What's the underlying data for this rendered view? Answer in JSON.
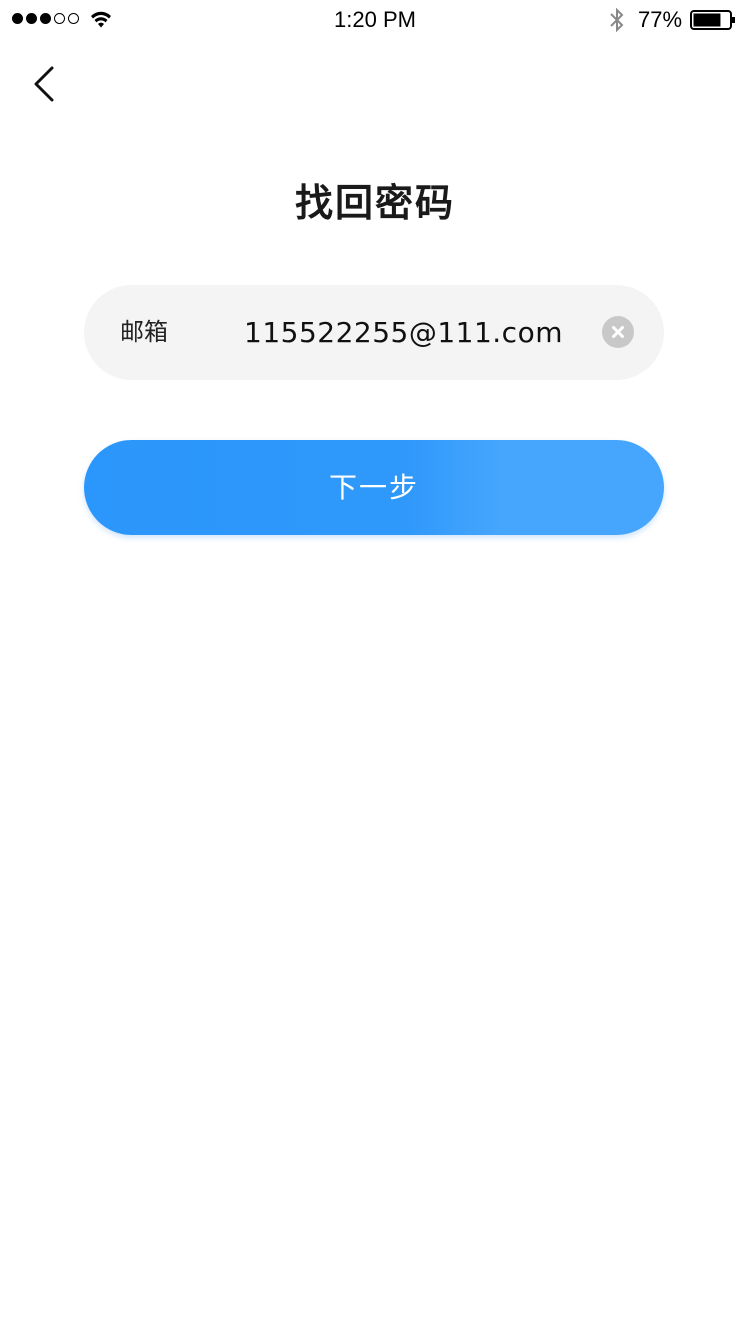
{
  "status_bar": {
    "time": "1:20 PM",
    "battery_percent": "77%",
    "battery_level": 0.77,
    "signal_bars_filled": 3,
    "signal_bars_total": 5
  },
  "header": {
    "back_icon": "chevron-left-icon"
  },
  "page": {
    "title": "找回密码"
  },
  "email_field": {
    "label": "邮箱",
    "value": "115522255@111.com",
    "clear_icon": "clear-icon"
  },
  "next_button": {
    "label": "下一步"
  },
  "colors": {
    "accent": "#2b96fb",
    "field_bg": "#f4f4f4",
    "clear_icon_bg": "#c8c8c8"
  }
}
